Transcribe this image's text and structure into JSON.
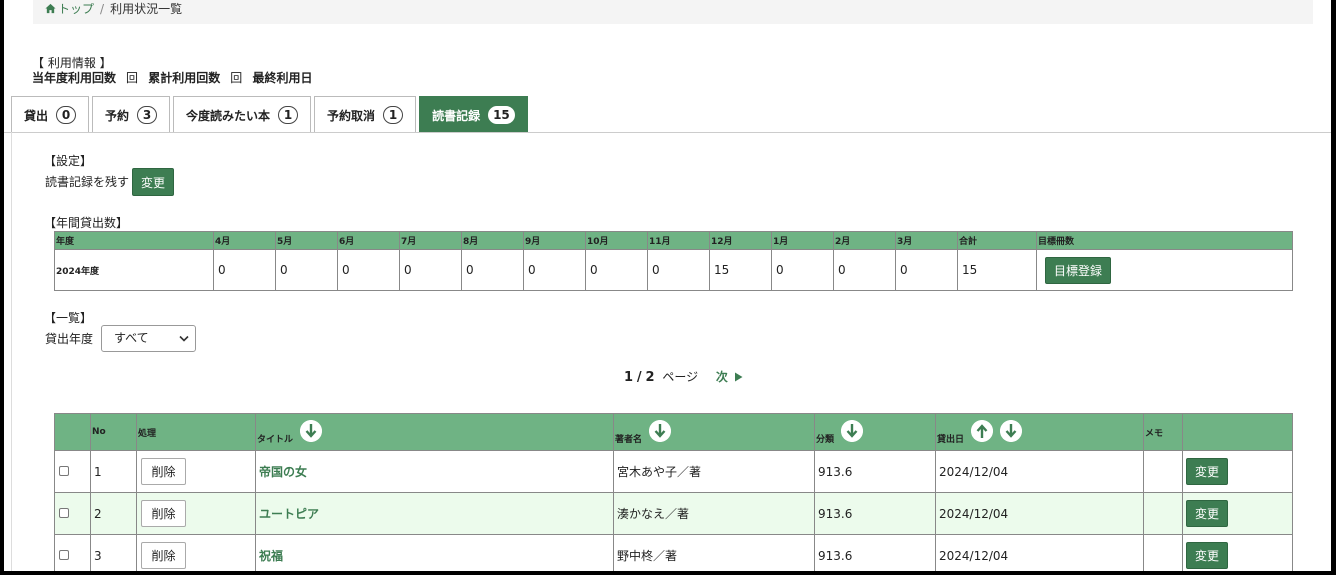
{
  "breadcrumb": {
    "home": "トップ",
    "separator": "/",
    "current": "利用状況一覧"
  },
  "usage_info": {
    "header": "【 利用情報 】",
    "stats": [
      {
        "label": "当年度利用回数",
        "value": "回"
      },
      {
        "label": "累計利用回数",
        "value": "回"
      },
      {
        "label": "最終利用日",
        "value": ""
      }
    ]
  },
  "tabs": [
    {
      "label": "貸出",
      "count": "0",
      "active": false
    },
    {
      "label": "予約",
      "count": "3",
      "active": false
    },
    {
      "label": "今度読みたい本",
      "count": "1",
      "active": false
    },
    {
      "label": "予約取消",
      "count": "1",
      "active": false
    },
    {
      "label": "読書記録",
      "count": "15",
      "active": true
    }
  ],
  "settings": {
    "heading": "【設定】",
    "label": "読書記録を残す",
    "button": "変更"
  },
  "annual": {
    "heading": "【年間貸出数】",
    "headers": [
      "年度",
      "4月",
      "5月",
      "6月",
      "7月",
      "8月",
      "9月",
      "10月",
      "11月",
      "12月",
      "1月",
      "2月",
      "3月",
      "合計",
      "目標冊数"
    ],
    "row": {
      "year": "2024年度",
      "values": [
        "0",
        "0",
        "0",
        "0",
        "0",
        "0",
        "0",
        "0",
        "15",
        "0",
        "0",
        "0",
        "15"
      ],
      "button": "目標登録"
    }
  },
  "list_section": {
    "heading": "【一覧】",
    "filter_label": "貸出年度",
    "filter_value": "すべて"
  },
  "pager": {
    "current": "1",
    "sep": "/",
    "total": "2",
    "unit": "ページ",
    "next": "次"
  },
  "list": {
    "headers": {
      "no": "No",
      "action": "処理",
      "title": "タイトル",
      "author": "著者名",
      "class": "分類",
      "date": "貸出日",
      "memo": "メモ"
    },
    "rows": [
      {
        "no": "1",
        "delete": "削除",
        "title": "帝国の女",
        "author": "宮木あや子／著",
        "class": "913.6",
        "date": "2024/12/04",
        "memo": "",
        "edit": "変更"
      },
      {
        "no": "2",
        "delete": "削除",
        "title": "ユートピア",
        "author": "湊かなえ／著",
        "class": "913.6",
        "date": "2024/12/04",
        "memo": "",
        "edit": "変更"
      },
      {
        "no": "3",
        "delete": "削除",
        "title": "祝福",
        "author": "野中柊／著",
        "class": "913.6",
        "date": "2024/12/04",
        "memo": "",
        "edit": "変更"
      }
    ]
  },
  "colors": {
    "accent": "#3d7d52",
    "header_bg": "#6fb384",
    "alt_row": "#ecfbec"
  }
}
